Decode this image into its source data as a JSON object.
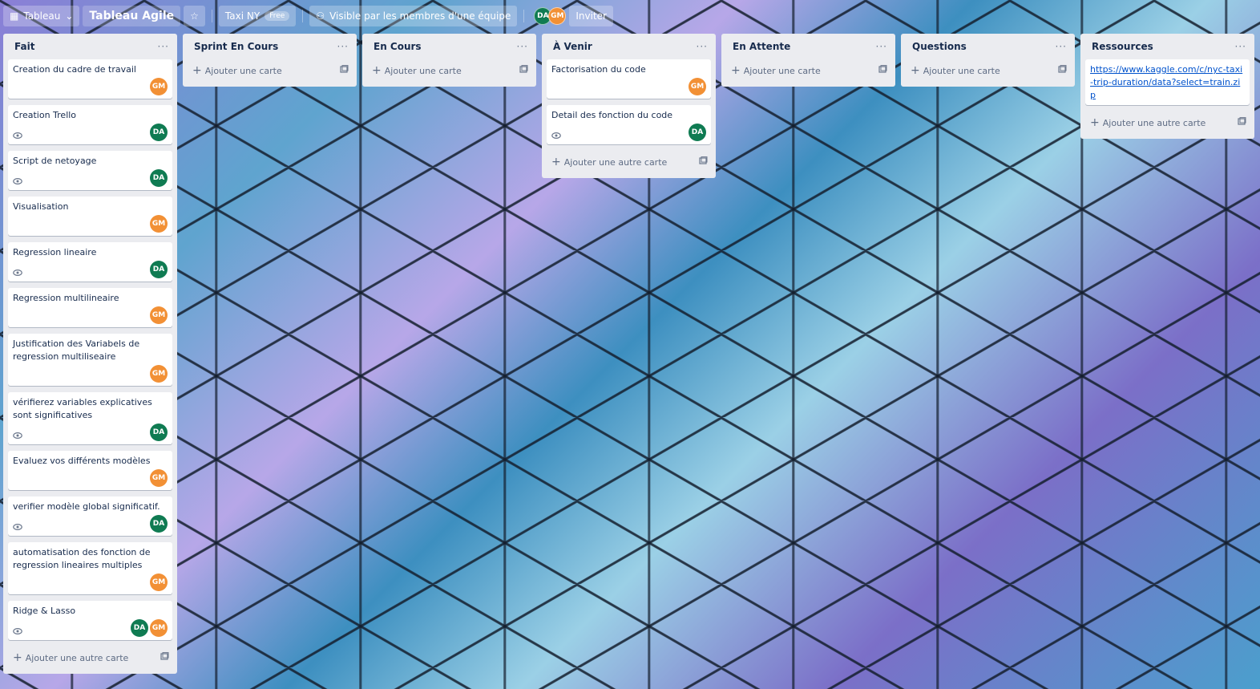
{
  "topbar": {
    "board_switcher": "Tableau",
    "board_title": "Tableau Agile",
    "workspace": "Taxi NY",
    "plan_badge": "Free",
    "visibility": "Visible par les membres d'une équipe",
    "invite": "Inviter",
    "members": [
      "DA",
      "GM"
    ]
  },
  "lists": [
    {
      "title": "Fait",
      "add_label": "Ajouter une autre carte",
      "cards": [
        {
          "text": "Creation du cadre de travail",
          "watch": false,
          "members": [
            "GM"
          ]
        },
        {
          "text": "Creation Trello",
          "watch": true,
          "members": [
            "DA"
          ]
        },
        {
          "text": "Script de netoyage",
          "watch": true,
          "members": [
            "DA"
          ]
        },
        {
          "text": "Visualisation",
          "watch": false,
          "members": [
            "GM"
          ]
        },
        {
          "text": "Regression lineaire",
          "watch": true,
          "members": [
            "DA"
          ]
        },
        {
          "text": "Regression multilineaire",
          "watch": false,
          "members": [
            "GM"
          ]
        },
        {
          "text": "Justification des Variabels de regression multiliseaire",
          "watch": false,
          "members": [
            "GM"
          ]
        },
        {
          "text": "vérifierez variables explicatives sont significatives",
          "watch": true,
          "members": [
            "DA"
          ]
        },
        {
          "text": "Evaluez vos différents modèles",
          "watch": false,
          "members": [
            "GM"
          ]
        },
        {
          "text": "verifier modèle global significatif.",
          "watch": true,
          "members": [
            "DA"
          ]
        },
        {
          "text": "automatisation des fonction de regression lineaires multiples",
          "watch": false,
          "members": [
            "GM"
          ]
        },
        {
          "text": "Ridge & Lasso",
          "watch": true,
          "members": [
            "DA",
            "GM"
          ]
        }
      ]
    },
    {
      "title": "Sprint En Cours",
      "add_label": "Ajouter une carte",
      "cards": []
    },
    {
      "title": "En Cours",
      "add_label": "Ajouter une carte",
      "cards": []
    },
    {
      "title": "À Venir",
      "add_label": "Ajouter une autre carte",
      "cards": [
        {
          "text": "Factorisation du code",
          "watch": false,
          "members": [
            "GM"
          ]
        },
        {
          "text": "Detail des fonction du code",
          "watch": true,
          "members": [
            "DA"
          ]
        }
      ]
    },
    {
      "title": "En Attente",
      "add_label": "Ajouter une carte",
      "cards": []
    },
    {
      "title": "Questions",
      "add_label": "Ajouter une carte",
      "cards": []
    },
    {
      "title": "Ressources",
      "add_label": "Ajouter une autre carte",
      "cards": [
        {
          "link": "https://www.kaggle.com/c/nyc-taxi-trip-duration/data?select=train.zip",
          "watch": false,
          "members": []
        }
      ]
    }
  ],
  "menu_glyph": "···"
}
